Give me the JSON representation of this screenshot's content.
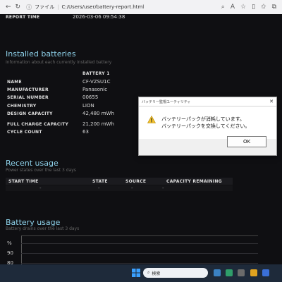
{
  "browser": {
    "file_label": "ファイル",
    "address": "C:/Users/user/battery-report.html"
  },
  "report": {
    "report_time_label": "REPORT TIME",
    "report_time_value": "2026-03-06  09:54:38"
  },
  "installed": {
    "title": "Installed batteries",
    "subtitle": "Information about each currently installed battery",
    "column": "BATTERY 1",
    "rows": [
      {
        "label": "NAME",
        "value": "CF-VZSU1C"
      },
      {
        "label": "MANUFACTURER",
        "value": "Panasonic"
      },
      {
        "label": "SERIAL NUMBER",
        "value": "00655"
      },
      {
        "label": "CHEMISTRY",
        "value": "LION"
      },
      {
        "label": "DESIGN CAPACITY",
        "value": "42,480 mWh"
      },
      {
        "label": "FULL CHARGE CAPACITY",
        "value": "21,200 mWh"
      },
      {
        "label": "CYCLE COUNT",
        "value": "63"
      }
    ]
  },
  "recent": {
    "title": "Recent usage",
    "subtitle": "Power states over the last 3 days",
    "headers": [
      "START TIME",
      "STATE",
      "SOURCE",
      "CAPACITY REMAINING"
    ],
    "row": [
      "-",
      "-",
      "-",
      "-"
    ]
  },
  "battery_usage": {
    "title": "Battery usage",
    "subtitle": "Battery drains over the last 3 days",
    "ticks": [
      "%",
      "90",
      "80"
    ]
  },
  "dialog": {
    "title": "バッテリー監視ユーティリティ",
    "line1": "バッテリーパックが消耗しています。",
    "line2": "バッテリーパックを交換してください。",
    "ok": "OK"
  },
  "taskbar": {
    "search_label": "検索"
  }
}
